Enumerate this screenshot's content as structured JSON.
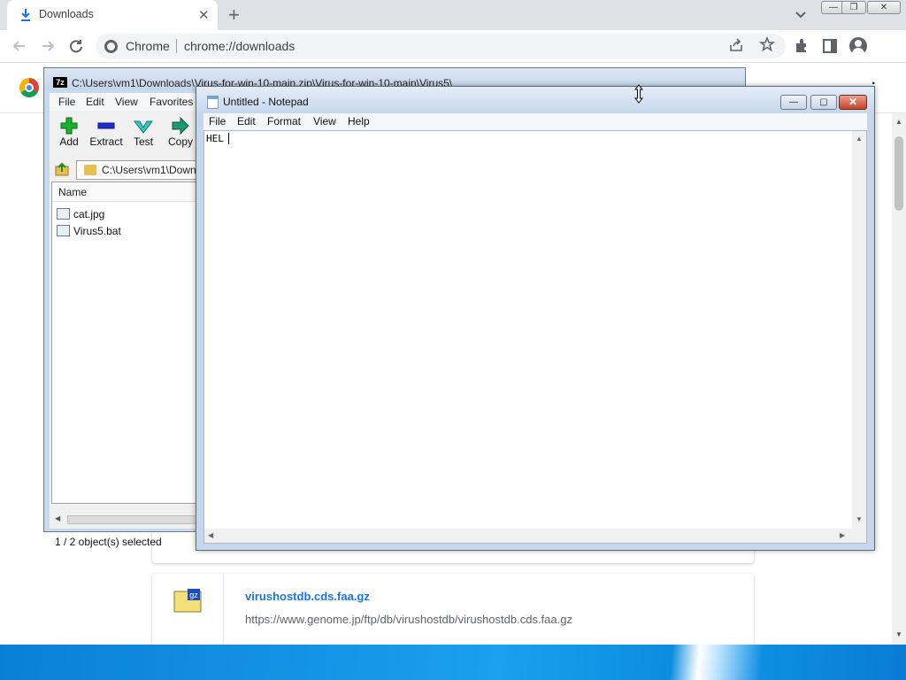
{
  "browser": {
    "tab": {
      "title": "Downloads",
      "icon": "download-icon",
      "close_glyph": "✕"
    },
    "new_tab_glyph": "+",
    "window_controls": {
      "minimize": "—",
      "restore": "❐",
      "close": "✕"
    },
    "omnibox": {
      "site_label": "Chrome",
      "url": "chrome://downloads"
    },
    "toolbar_icons": [
      "back-icon",
      "forward-icon",
      "reload-icon",
      "share-icon",
      "bookmark-star-icon",
      "extensions-icon",
      "side-panel-icon",
      "profile-icon",
      "menu-icon"
    ]
  },
  "downloads_page": {
    "item": {
      "file_name": "virushostdb.cds.faa.gz",
      "url": "https://www.genome.jp/ftp/db/virushostdb/virushostdb.cds.faa.gz",
      "icon_badge": "gz"
    }
  },
  "zip_window": {
    "logo": "7z",
    "title": "C:\\Users\\vm1\\Downloads\\Virus-for-win-10-main.zip\\Virus-for-win-10-main\\Virus5\\",
    "menu": [
      "File",
      "Edit",
      "View",
      "Favorites"
    ],
    "toolbar": [
      "Add",
      "Extract",
      "Test",
      "Copy"
    ],
    "location": "C:\\Users\\vm1\\Down",
    "column_header": "Name",
    "files": [
      "cat.jpg",
      "Virus5.bat"
    ],
    "status": "1 / 2 object(s) selected"
  },
  "notepad": {
    "title": "Untitled - Notepad",
    "menu": [
      "File",
      "Edit",
      "Format",
      "View",
      "Help"
    ],
    "content": "HEL",
    "controls": {
      "minimize": "—",
      "maximize": "▢",
      "close": "✕"
    }
  },
  "colors": {
    "chrome_tabstrip": "#dee1e6",
    "link_blue": "#1a73e8",
    "taskbar_blue": "#1aa0ee",
    "aero_frame": "#c6d7ec",
    "close_red": "#c4432a"
  }
}
